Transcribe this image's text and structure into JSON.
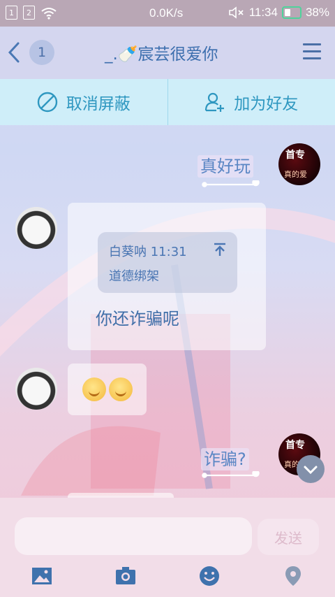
{
  "status": {
    "sim1": "1",
    "sim2": "2",
    "net_speed": "0.0K/s",
    "time": "11:34",
    "battery": "38%"
  },
  "header": {
    "unread_badge": "1",
    "title": "_.🍼宸芸很爱你"
  },
  "actions": {
    "unblock_label": "取消屏蔽",
    "add_friend_label": "加为好友"
  },
  "messages": {
    "m1_text": "真好玩",
    "quote_header": "白葵呐 11:31",
    "quote_text": "道德绑架",
    "m2_text": "你还诈骗呢",
    "m4_text": "诈骗?"
  },
  "self_avatar": {
    "text_top": "首专",
    "text_bottom": "真的爱"
  },
  "composer": {
    "send_label": "发送",
    "input_value": ""
  },
  "icons": [
    "back-icon",
    "menu-icon",
    "block-icon",
    "add-friend-icon",
    "image-icon",
    "camera-icon",
    "emoji-icon",
    "location-icon",
    "scroll-down-icon",
    "reply-arrow-icon"
  ],
  "colors": {
    "accent": "#2e97c0",
    "title": "#3d6fae",
    "statusbar": "#b9a7b5",
    "actionbar": "#cfeef9",
    "battery_outline": "#4fd39b"
  }
}
